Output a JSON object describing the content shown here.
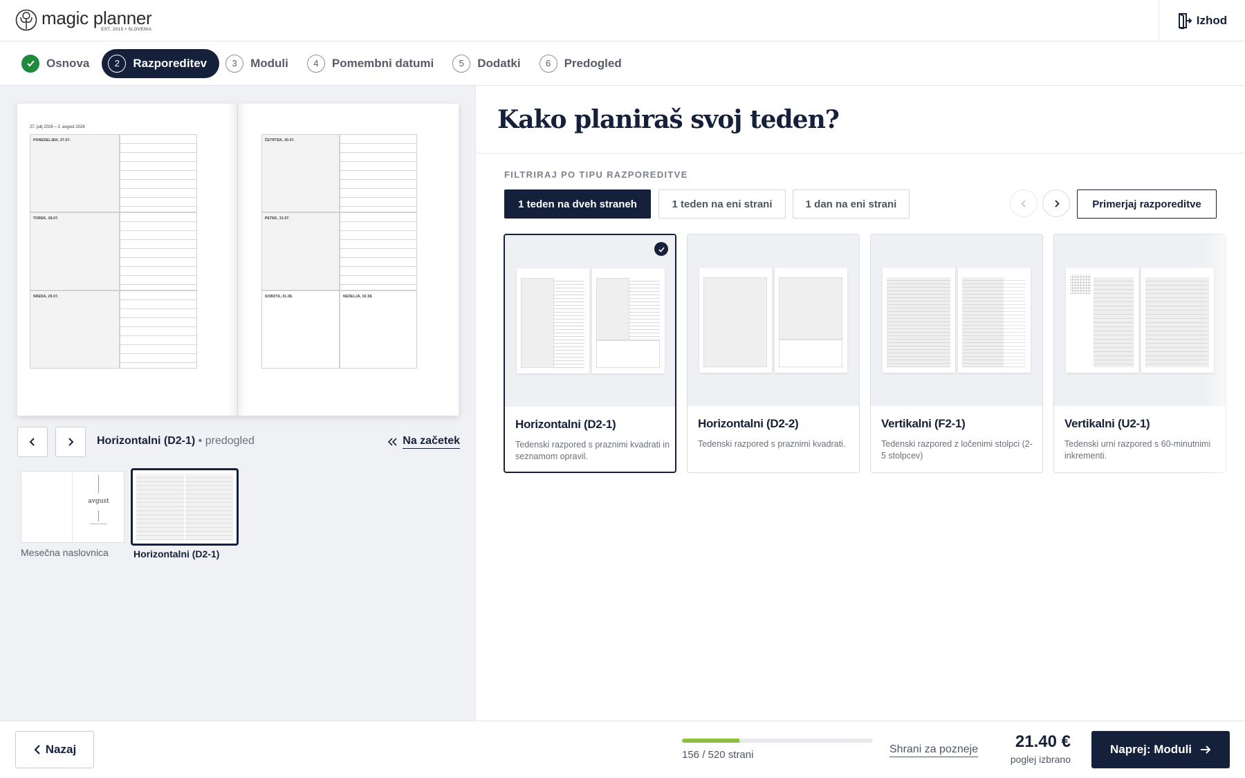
{
  "brand": {
    "name": "magic planner",
    "tagline": "EST. 2015 • SLOVENIA"
  },
  "header": {
    "exit_label": "Izhod"
  },
  "steps": [
    {
      "num": "1",
      "label": "Osnova",
      "state": "done"
    },
    {
      "num": "2",
      "label": "Razporeditev",
      "state": "active"
    },
    {
      "num": "3",
      "label": "Moduli",
      "state": "todo"
    },
    {
      "num": "4",
      "label": "Pomembni datumi",
      "state": "todo"
    },
    {
      "num": "5",
      "label": "Dodatki",
      "state": "todo"
    },
    {
      "num": "6",
      "label": "Predogled",
      "state": "todo"
    }
  ],
  "preview": {
    "date_range": "27. julij 2026 – 2. avgust 2026",
    "days": {
      "mon": "PONEDELJEK, 27.07.",
      "tue": "TOREK, 28.07.",
      "wed": "SREDA, 29.07.",
      "thu": "ČETRTEK, 30.07.",
      "fri": "PETEK, 31.07.",
      "sat": "SOBOTA, 01.08.",
      "sun": "NEDELJA, 02.08."
    },
    "layout_name": "Horizontalni (D2-1)",
    "layout_suffix": "• predogled",
    "to_start_label": "Na začetek",
    "thumbnails": [
      {
        "caption": "Mesečna naslovnica",
        "month_text": "avgust",
        "selected": false
      },
      {
        "caption": "Horizontalni (D2-1)",
        "selected": true
      }
    ]
  },
  "main": {
    "title": "Kako planiraš svoj teden?",
    "filter_label": "FILTRIRAJ PO TIPU RAZPOREDITVE",
    "filters": [
      {
        "label": "1 teden na dveh straneh",
        "active": true
      },
      {
        "label": "1 teden na eni strani",
        "active": false
      },
      {
        "label": "1 dan na eni strani",
        "active": false
      }
    ],
    "compare_label": "Primerjaj razporeditve",
    "layouts": [
      {
        "title": "Horizontalni (D2-1)",
        "desc": "Tedenski razpored s praznimi kvadrati in seznamom opravil.",
        "selected": true
      },
      {
        "title": "Horizontalni (D2-2)",
        "desc": "Tedenski razpored s praznimi kvadrati.",
        "selected": false
      },
      {
        "title": "Vertikalni (F2-1)",
        "desc": "Tedenski razpored z ločenimi stolpci (2-5 stolpcev)",
        "selected": false
      },
      {
        "title": "Vertikalni (U2-1)",
        "desc": "Tedenski urni razpored s 60-minutnimi inkrementi.",
        "selected": false
      }
    ]
  },
  "footer": {
    "back_label": "Nazaj",
    "pages_text": "156 / 520 strani",
    "pages_progress": 0.3,
    "save_label": "Shrani za pozneje",
    "price": "21.40 €",
    "price_sub": "poglej izbrano",
    "next_label": "Naprej: Moduli"
  },
  "colors": {
    "primary": "#15203a",
    "success": "#1f8a3b",
    "progress": "#8cbf3f"
  }
}
